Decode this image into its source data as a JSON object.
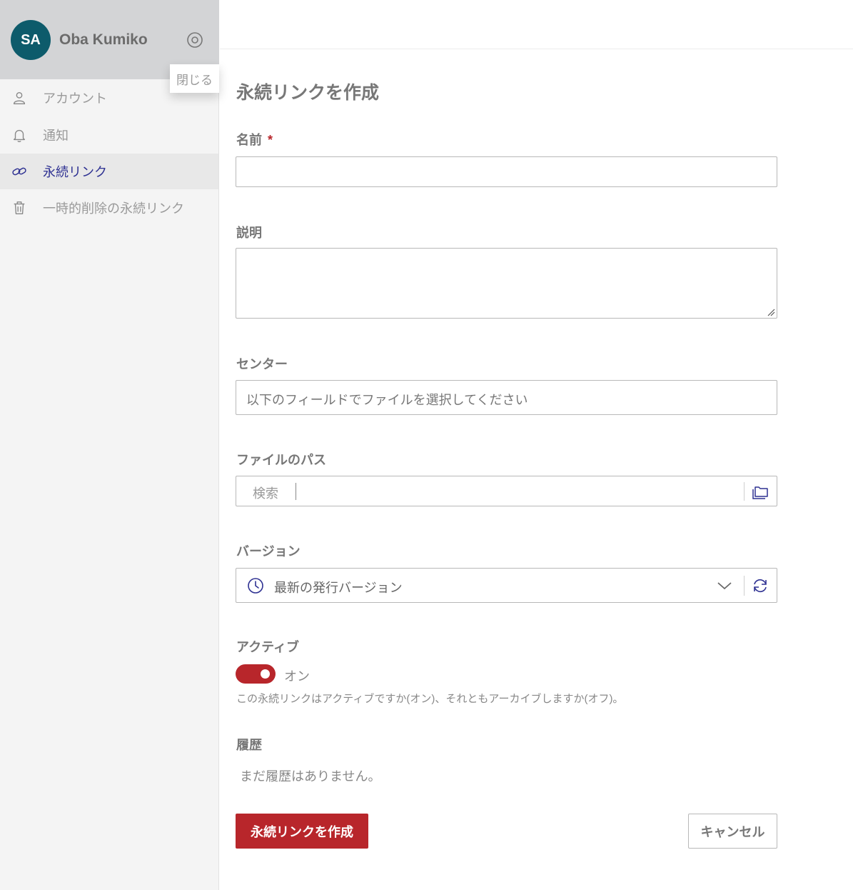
{
  "sidebar": {
    "avatar_initials": "SA",
    "user_name": "Oba Kumiko",
    "tooltip": "閉じる",
    "items": [
      {
        "label": "アカウント",
        "icon": "user-icon"
      },
      {
        "label": "通知",
        "icon": "bell-icon"
      },
      {
        "label": "永続リンク",
        "icon": "link-icon",
        "active": true
      },
      {
        "label": "一時的削除の永続リンク",
        "icon": "trash-icon"
      }
    ]
  },
  "form": {
    "title": "永続リンクを作成",
    "name_label": "名前",
    "required_mark": "*",
    "description_label": "説明",
    "center_label": "センター",
    "center_value": "以下のフィールドでファイルを選択してください",
    "filepath_label": "ファイルのパス",
    "search_label": "検索",
    "version_label": "バージョン",
    "version_value": "最新の発行バージョン",
    "active_label": "アクティブ",
    "toggle_state": "オン",
    "active_help": "この永続リンクはアクティブですか(オン)、それともアーカイブしますか(オフ)。",
    "history_label": "履歴",
    "history_empty": "まだ履歴はありません。",
    "submit_label": "永続リンクを作成",
    "cancel_label": "キャンセル"
  },
  "colors": {
    "accent": "#b8262b",
    "avatar_bg": "#0d5b6b",
    "active_nav": "#2e3192"
  }
}
